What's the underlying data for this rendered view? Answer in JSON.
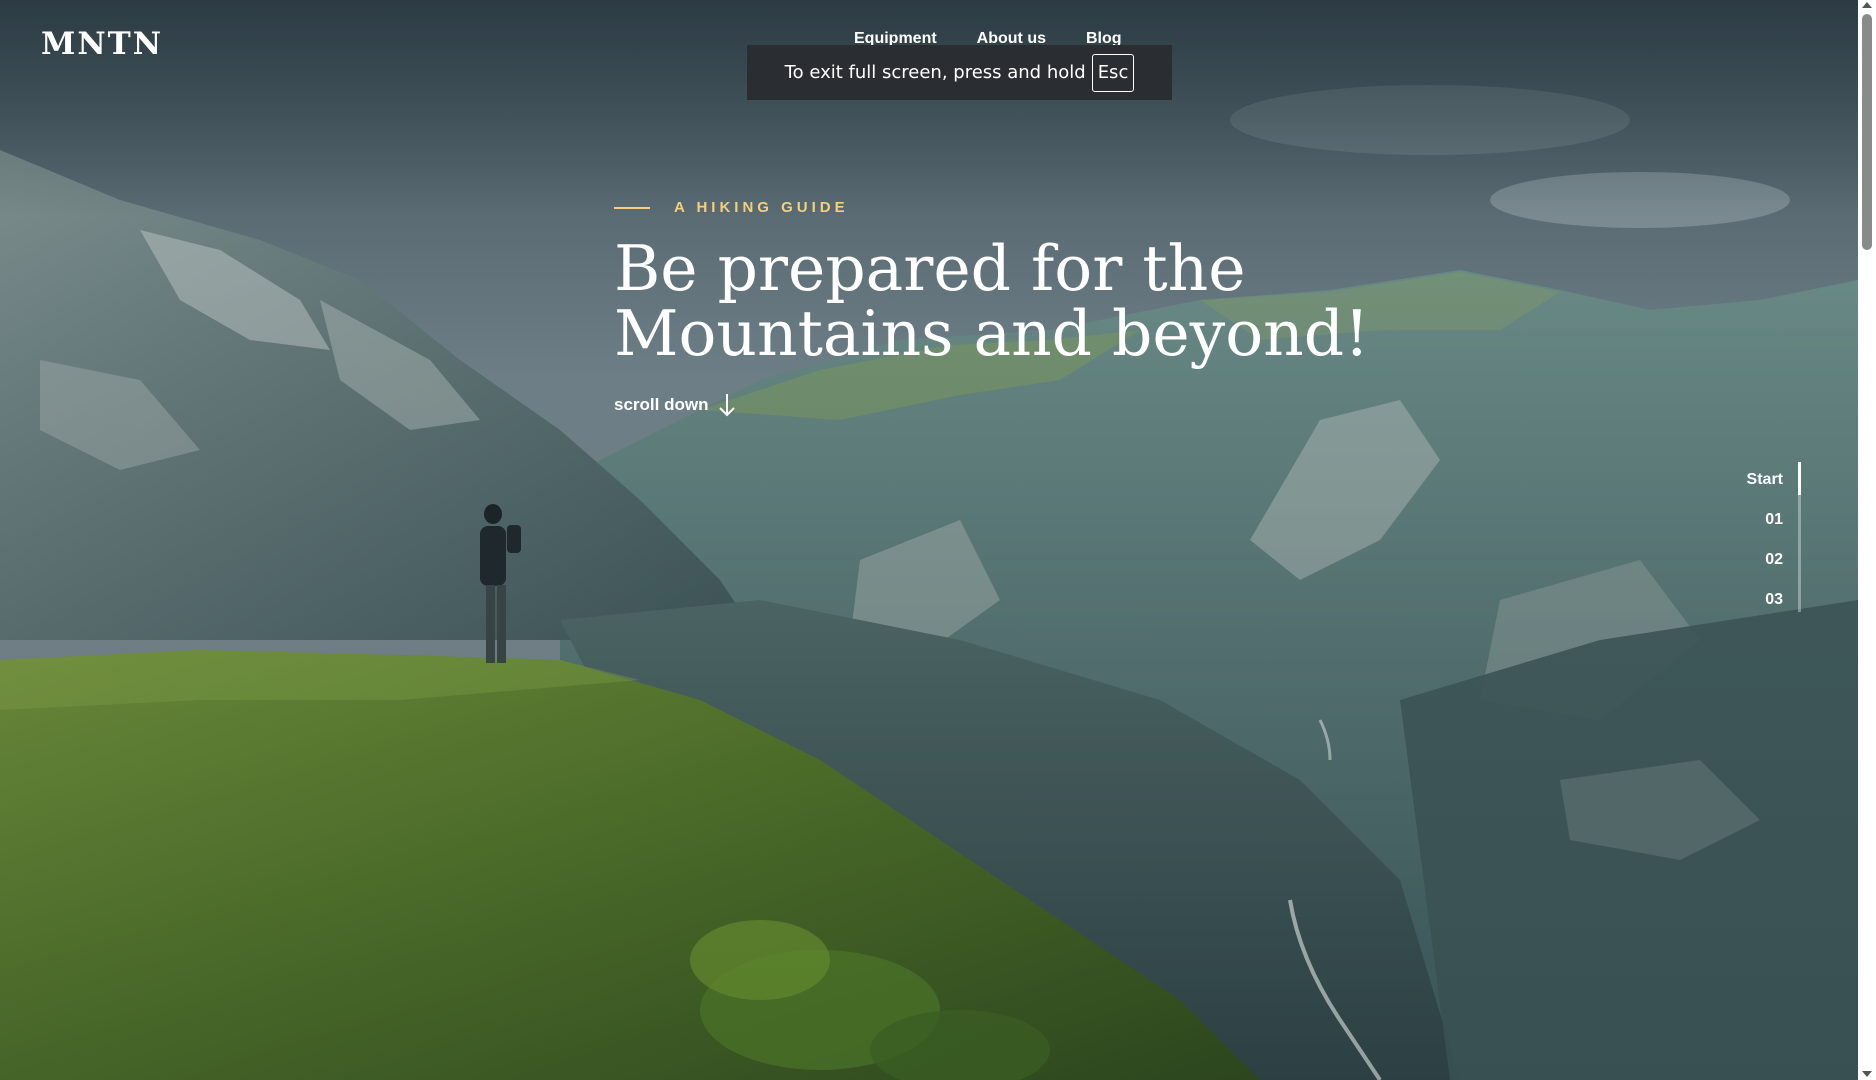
{
  "header": {
    "logo": "MNTN",
    "nav": [
      {
        "label": "Equipment"
      },
      {
        "label": "About us"
      },
      {
        "label": "Blog"
      }
    ]
  },
  "fullscreen_toast": {
    "message": "To exit full screen, press and hold",
    "key": "Esc"
  },
  "hero": {
    "eyebrow": "A HIKING GUIDE",
    "headline_line1": "Be prepared for the",
    "headline_line2": "Mountains and beyond!",
    "scroll_label": "scroll down"
  },
  "side_nav": {
    "items": [
      "Start",
      "01",
      "02",
      "03"
    ],
    "progress_fraction": 0.22
  },
  "colors": {
    "accent": "#f5cf7f",
    "text": "#ffffff",
    "toast_bg": "#2a2e33"
  },
  "icons": {
    "scroll": "arrow-down-icon"
  }
}
